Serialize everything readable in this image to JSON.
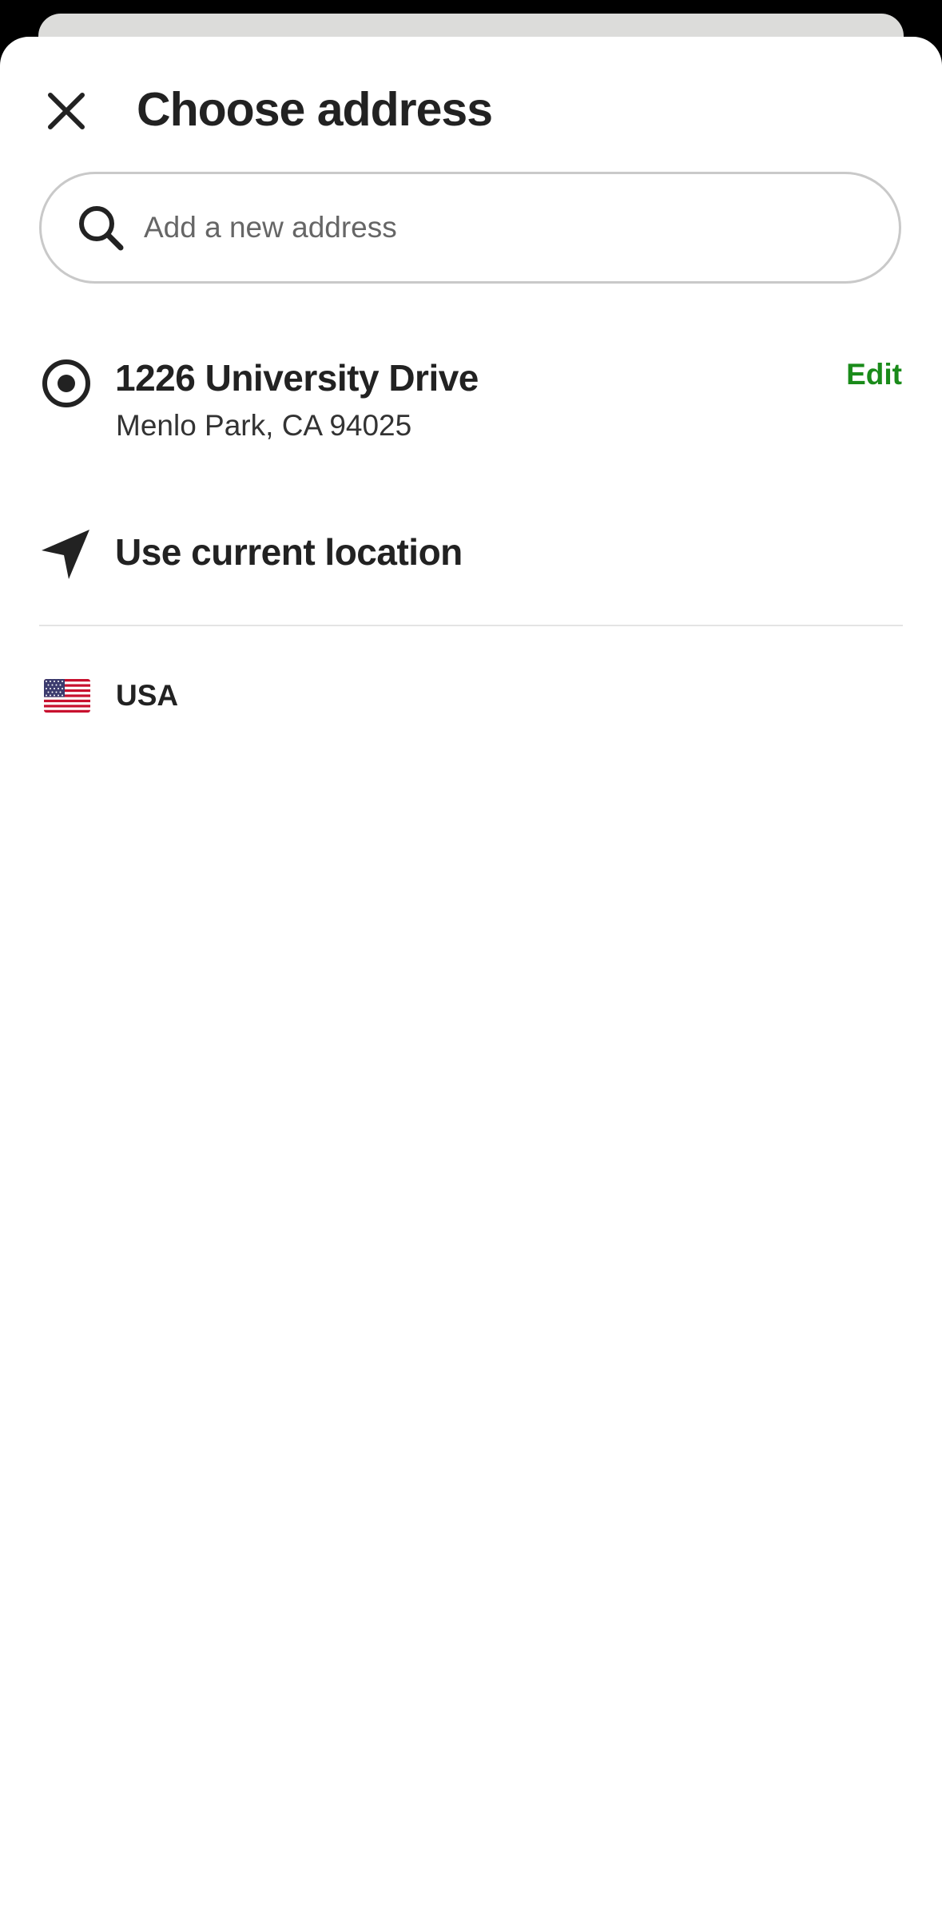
{
  "header": {
    "title": "Choose address"
  },
  "search": {
    "placeholder": "Add a new address",
    "value": ""
  },
  "saved_address": {
    "selected": true,
    "line1": "1226 University Drive",
    "line2": "Menlo Park, CA 94025",
    "edit_label": "Edit"
  },
  "current_location": {
    "label": "Use current location"
  },
  "country": {
    "label": "USA",
    "flag_icon": "us-flag-icon"
  },
  "colors": {
    "accent_green": "#1a8b1a",
    "text_primary": "#222222",
    "border": "#c9c9c9"
  }
}
